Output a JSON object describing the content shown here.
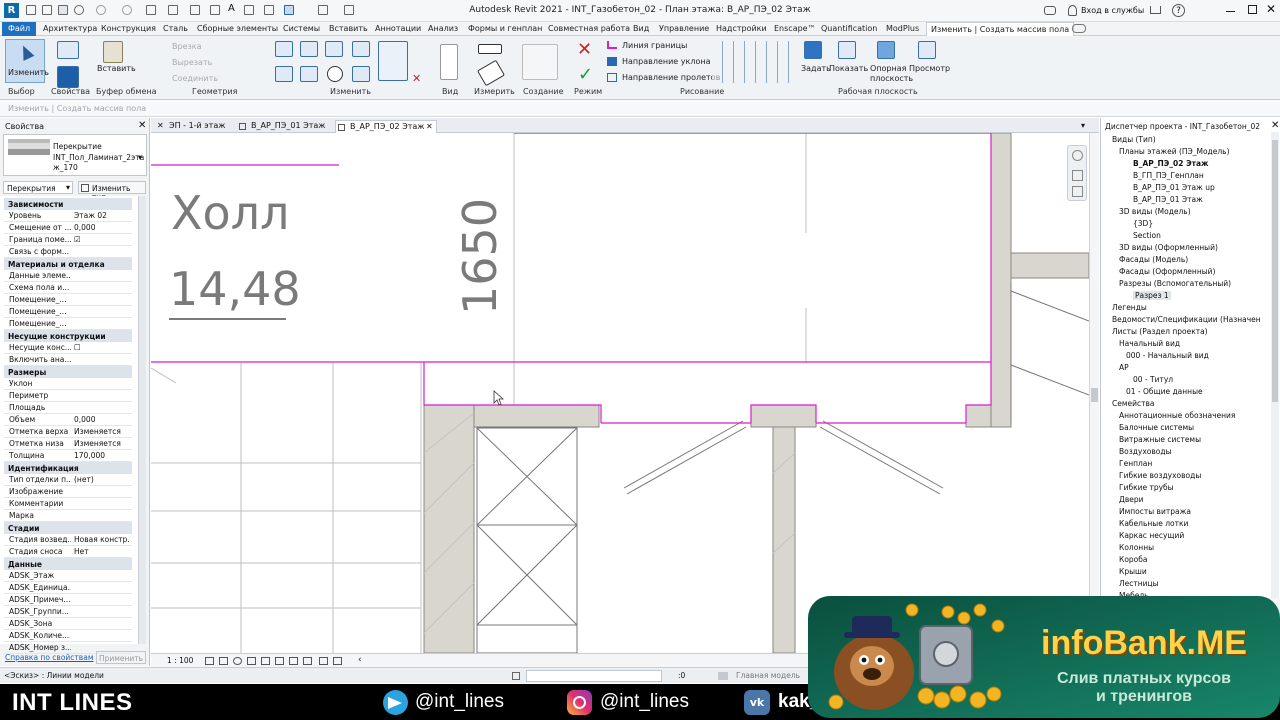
{
  "app": {
    "title": "Autodesk Revit 2021 - INT_Газобетон_02 - План этажа: В_АР_ПЭ_02 Этаж",
    "signin": "Вход в службы"
  },
  "menu": {
    "tabs": [
      "Файл",
      "Архитектура",
      "Конструкция",
      "Сталь",
      "Сборные элементы",
      "Системы",
      "Вставить",
      "Аннотации",
      "Анализ",
      "Формы и генплан",
      "Совместная работа",
      "Вид",
      "Управление",
      "Надстройки",
      "Enscape™",
      "Quantification",
      "ModPlus",
      "Изменить | Создать массив пола"
    ]
  },
  "ribbon": {
    "modify": "Изменить",
    "insert": "Вставить",
    "properties": "Свойства",
    "disabled": [
      "Врезка",
      "Вырезать",
      "Соединить"
    ],
    "boundary_line": "Линия границы",
    "slope_arrow": "Направление уклона",
    "span_direction": "Направление пролетов",
    "set": "Задать",
    "show": "Показать",
    "ref_plane": "Опорная плоскость",
    "viewer": "Просмотр",
    "groups": [
      "Выбор",
      "Свойства",
      "Буфер обмена",
      "Геометрия",
      "Изменить",
      "Вид",
      "Измерить",
      "Создание",
      "Режим",
      "Рисование",
      "Рабочая плоскость"
    ]
  },
  "status_strip": "Изменить | Создать массив пола",
  "properties": {
    "header": "Свойства",
    "type_family": "Перекрытие",
    "type_name_line1": "INT_Пол_Ламинат_2эта",
    "type_name_line2": "ж_170",
    "category": "Перекрытия",
    "edit_type": "Изменить тип",
    "sections": [
      {
        "title": "Зависимости",
        "rows": [
          [
            "Уровень",
            "Этаж 02"
          ],
          [
            "Смещение от ...",
            "0,000"
          ],
          [
            "Граница поме...",
            "☑"
          ],
          [
            "Связь с форм...",
            ""
          ]
        ]
      },
      {
        "title": "Материалы и отделка",
        "rows": [
          [
            "Данные элеме...",
            ""
          ],
          [
            "Схема пола и...",
            ""
          ],
          [
            "Помещение_...",
            ""
          ],
          [
            "Помещение_...",
            ""
          ],
          [
            "Помещение_...",
            ""
          ]
        ]
      },
      {
        "title": "Несущие конструкции",
        "rows": [
          [
            "Несущие конс...",
            "☐"
          ],
          [
            "Включить ана...",
            ""
          ]
        ]
      },
      {
        "title": "Размеры",
        "rows": [
          [
            "Уклон",
            ""
          ],
          [
            "Периметр",
            ""
          ],
          [
            "Площадь",
            ""
          ],
          [
            "Объем",
            "0,000"
          ],
          [
            "Отметка верха",
            "Изменяется"
          ],
          [
            "Отметка низа",
            "Изменяется"
          ],
          [
            "Толщина",
            "170,000"
          ]
        ]
      },
      {
        "title": "Идентификация",
        "rows": [
          [
            "Тип отделки п...",
            "(нет)"
          ],
          [
            "Изображение",
            ""
          ],
          [
            "Комментарии",
            ""
          ],
          [
            "Марка",
            ""
          ]
        ]
      },
      {
        "title": "Стадии",
        "rows": [
          [
            "Стадия возвед...",
            "Новая констр..."
          ],
          [
            "Стадия сноса",
            "Нет"
          ]
        ]
      },
      {
        "title": "Данные",
        "rows": [
          [
            "ADSK_Этаж",
            ""
          ],
          [
            "ADSK_Единица...",
            ""
          ],
          [
            "ADSK_Примеч...",
            ""
          ],
          [
            "ADSK_Группи...",
            ""
          ],
          [
            "ADSK_Зона",
            ""
          ],
          [
            "ADSK_Количе...",
            ""
          ],
          [
            "ADSK_Номер з...",
            ""
          ]
        ]
      }
    ],
    "help_link": "Справка по свойствам",
    "apply": "Применить"
  },
  "view_tabs": [
    "ЭП - 1-й этаж",
    "В_АР_ПЭ_01 Этаж",
    "В_АР_ПЭ_02 Этаж"
  ],
  "canvas": {
    "room_name": "Холл",
    "room_area": "14,48",
    "dimension": "1650"
  },
  "view_bar": {
    "scale": "1 : 100"
  },
  "browser": {
    "header": "Диспетчер проекта - INT_Газобетон_02",
    "items": [
      "Виды (Тип)",
      "Планы этажей (ПЭ_Модель)",
      "В_АР_ПЭ_02 Этаж",
      "В_ГП_ПЭ_Генплан",
      "В_АР_ПЭ_01 Этаж up",
      "В_АР_ПЭ_01 Этаж",
      "3D виды (Модель)",
      "{3D}",
      "Section",
      "3D виды (Оформленный)",
      "Фасады (Модель)",
      "Фасады (Оформленный)",
      "Разрезы (Вспомогательный)",
      "Разрез 1",
      "Легенды",
      "Ведомости/Спецификации (Назначен",
      "Листы (Раздел проекта)",
      "Начальный вид",
      "000 - Начальный вид",
      "АР",
      "00 - Титул",
      "01 - Общие данные",
      "Семейства",
      "Аннотационные обозначения",
      "Балочные системы",
      "Витражные системы",
      "Воздуховоды",
      "Генплан",
      "Гибкие воздуховоды",
      "Гибкие трубы",
      "Двери",
      "Импосты витража",
      "Кабельные лотки",
      "Каркас несущий",
      "Колонны",
      "Короба",
      "Крыши",
      "Лестницы",
      "Мебель"
    ]
  },
  "bottom_status": {
    "hint": "<Эскиз> : Линии модели",
    "zero": ":0",
    "model": "Главная модель"
  },
  "footer": {
    "brand": "INT LINES",
    "tg": "@int_lines",
    "ig": "@int_lines",
    "vk": "kak_"
  },
  "promo": {
    "brand": "infoBank.ME",
    "line1": "Слив платных курсов",
    "line2": "и тренингов"
  },
  "colors": {
    "accent": "#0070c0",
    "sketch": "#d71fcf",
    "wall": "#d9d5cf",
    "ribbon_bg": "#f0f3f6",
    "footer_bg": "#000000",
    "promo_bg": "#0f6d55",
    "promo_text": "#ffd24a"
  }
}
